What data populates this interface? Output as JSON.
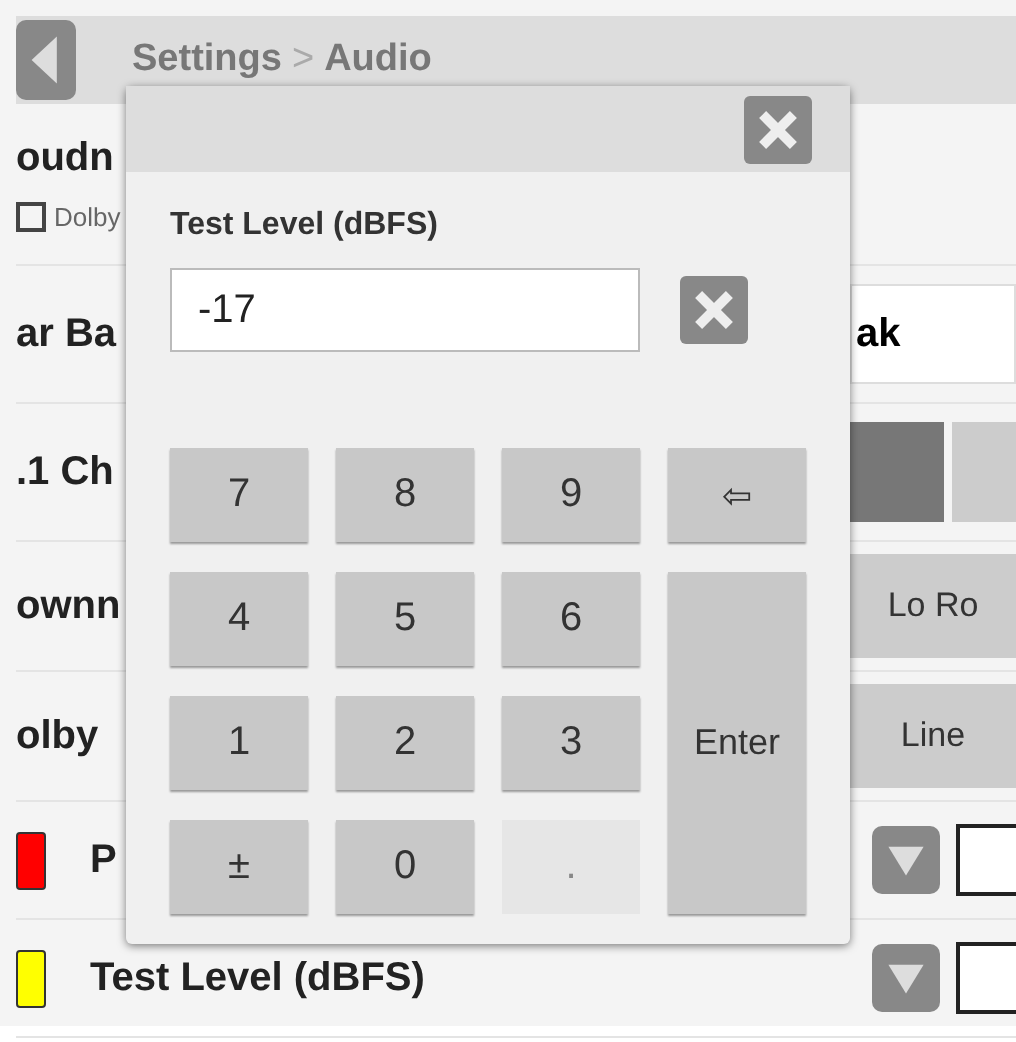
{
  "header": {
    "breadcrumbs": [
      "Settings",
      "Audio"
    ],
    "separator": ">"
  },
  "rows": [
    {
      "kind": "section",
      "label": "oudn",
      "option": {
        "label": "Dolby",
        "checked": false
      }
    },
    {
      "kind": "field",
      "label": "ar Ba",
      "value": "ak"
    },
    {
      "kind": "segments",
      "label": ".1 Ch",
      "segments": [
        {
          "selected": true
        },
        {
          "selected": false
        }
      ]
    },
    {
      "kind": "button",
      "label": "ownn",
      "button": "Lo Ro"
    },
    {
      "kind": "button",
      "label": "olby",
      "button": "Line"
    },
    {
      "kind": "legend",
      "label": "P",
      "color": "#ff0000"
    },
    {
      "kind": "legend",
      "label": "Test Level (dBFS)",
      "color": "#ffff00"
    }
  ],
  "dialog": {
    "label": "Test Level (dBFS)",
    "value": "-17",
    "keys": [
      {
        "kind": "digit",
        "label": "7",
        "disabled": false
      },
      {
        "kind": "digit",
        "label": "8",
        "disabled": false
      },
      {
        "kind": "digit",
        "label": "9",
        "disabled": false
      },
      {
        "kind": "backspace",
        "label": "⇦",
        "disabled": false
      },
      {
        "kind": "digit",
        "label": "4",
        "disabled": false
      },
      {
        "kind": "digit",
        "label": "5",
        "disabled": false
      },
      {
        "kind": "digit",
        "label": "6",
        "disabled": false
      },
      {
        "kind": "digit",
        "label": "1",
        "disabled": false
      },
      {
        "kind": "digit",
        "label": "2",
        "disabled": false
      },
      {
        "kind": "digit",
        "label": "3",
        "disabled": false
      },
      {
        "kind": "enter",
        "label": "Enter",
        "disabled": false
      },
      {
        "kind": "sign",
        "label": "±",
        "disabled": false
      },
      {
        "kind": "digit",
        "label": "0",
        "disabled": false
      },
      {
        "kind": "digit",
        "label": ".",
        "disabled": true
      }
    ]
  }
}
